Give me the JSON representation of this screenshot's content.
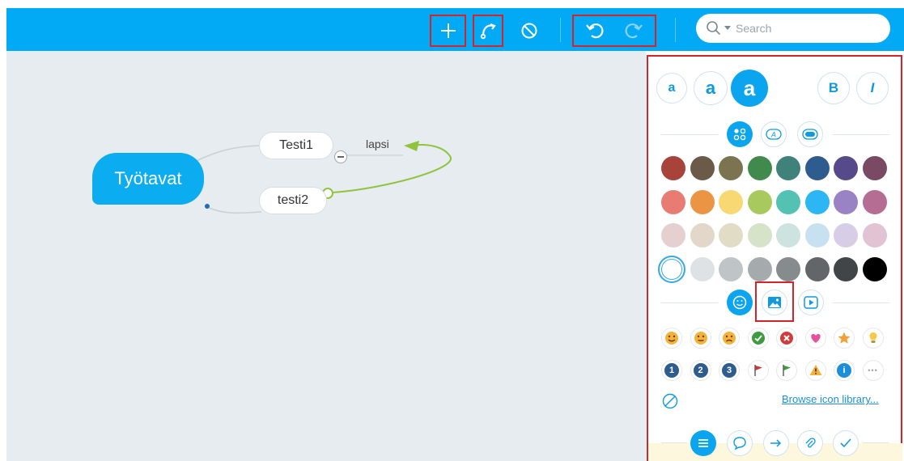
{
  "toolbar": {
    "buttons": [
      {
        "icon": "plus-icon",
        "label": "Add topic"
      },
      {
        "icon": "relationship-icon",
        "label": "Relationship"
      },
      {
        "icon": "no-entry-icon",
        "label": "Disable"
      },
      {
        "icon": "undo-icon",
        "label": "Undo"
      },
      {
        "icon": "redo-icon",
        "label": "Redo"
      }
    ],
    "search": {
      "placeholder": "Search"
    }
  },
  "map": {
    "root": "Työtavat",
    "children": [
      "Testi1",
      "testi2"
    ],
    "relationship_label": "lapsi"
  },
  "panel": {
    "font_sizes": [
      "a",
      "a",
      "a"
    ],
    "bold": "B",
    "italic": "I",
    "shape_tabs": [
      "theme-icon",
      "text-style-icon",
      "shape-style-icon"
    ],
    "colors": [
      [
        "#a8433c",
        "#6b5a48",
        "#7c7350",
        "#3f8a4c",
        "#3f817b",
        "#2f5c8f",
        "#574a8a",
        "#7a4a64"
      ],
      [
        "#e87c73",
        "#eb9444",
        "#f7d873",
        "#a8c95d",
        "#53c2b3",
        "#2cb7f4",
        "#9a83c4",
        "#b56d93"
      ],
      [
        "#e5cfcf",
        "#e2d7c8",
        "#e0dcc6",
        "#d7e3c8",
        "#cde3df",
        "#c8e1f0",
        "#d8cde6",
        "#e2c3d4"
      ],
      [
        "#ffffff",
        "#dfe2e4",
        "#bfc4c6",
        "#a5aaac",
        "#868b8e",
        "#626669",
        "#424548",
        "#000000"
      ]
    ],
    "icon_tabs": [
      "smiley-tab-icon",
      "image-tab-icon",
      "play-tab-icon"
    ],
    "icon_row1": [
      "smile-icon",
      "neutral-icon",
      "sad-icon",
      "check-icon",
      "cross-icon",
      "heart-icon",
      "star-icon",
      "bulb-icon"
    ],
    "icon_row2": [
      {
        "name": "number-1-icon",
        "text": "1"
      },
      {
        "name": "number-2-icon",
        "text": "2"
      },
      {
        "name": "number-3-icon",
        "text": "3"
      },
      {
        "name": "red-flag-icon",
        "text": ""
      },
      {
        "name": "green-flag-icon",
        "text": ""
      },
      {
        "name": "warning-icon",
        "text": ""
      },
      {
        "name": "info-icon",
        "text": "i"
      },
      {
        "name": "more-icon",
        "text": "•••"
      }
    ],
    "browse_label": "Browse icon library...",
    "bottom_tabs": [
      "format-tab-icon",
      "comment-tab-icon",
      "link-tab-icon",
      "attachment-tab-icon",
      "task-tab-icon"
    ]
  }
}
